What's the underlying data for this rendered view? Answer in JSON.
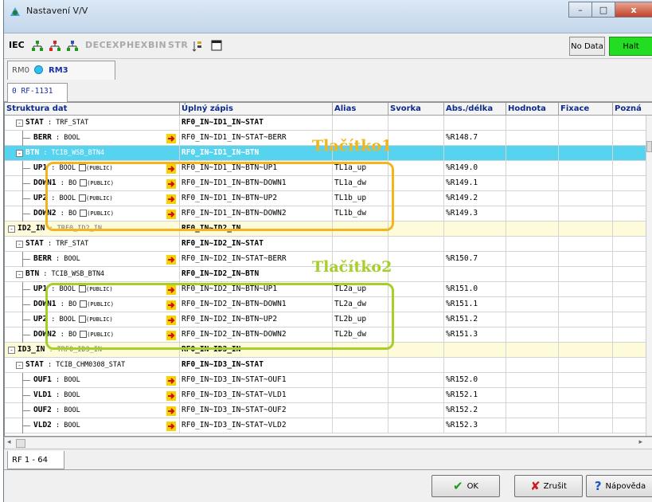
{
  "window": {
    "title": "Nastavení V/V",
    "minimize": "–",
    "maximize": "□",
    "close": "x"
  },
  "toolbar": {
    "iec": "IEC",
    "formats": [
      "DEC",
      "EXP",
      "HEX",
      "BIN",
      "STR"
    ],
    "status_nodata": "No Data",
    "status_halt": "Halt"
  },
  "tabs_modules": [
    "RM0",
    "RM3"
  ],
  "tabs_rf": [
    "0 RF-1131"
  ],
  "columns": [
    "Struktura dat",
    "Úplný zápis",
    "Alias",
    "Svorka",
    "Abs./délka",
    "Hodnota",
    "Fixace",
    "Pozná"
  ],
  "rows": [
    {
      "name": "STAT",
      "type": " : TRF_STAT",
      "full": "RF0_IN~ID1_IN~STAT",
      "alias": "",
      "abs": ""
    },
    {
      "name": "BERR",
      "type": " : BOOL",
      "full": "RF0_IN~ID1_IN~STAT~BERR",
      "alias": "",
      "abs": "%R148.7"
    },
    {
      "name": "BTN",
      "type": " : TCIB_WSB_BTN4",
      "full": "RF0_IN~ID1_IN~BTN",
      "alias": "",
      "abs": ""
    },
    {
      "name": "UP1",
      "type": " : BOOL",
      "pub": "(PUBLIC)",
      "full": "RF0_IN~ID1_IN~BTN~UP1",
      "alias": "TL1a_up",
      "abs": "%R149.0"
    },
    {
      "name": "DOWN1",
      "type": " : BO",
      "pub": "(PUBLIC)",
      "full": "RF0_IN~ID1_IN~BTN~DOWN1",
      "alias": "TL1a_dw",
      "abs": "%R149.1"
    },
    {
      "name": "UP2",
      "type": " : BOOL",
      "pub": "(PUBLIC)",
      "full": "RF0_IN~ID1_IN~BTN~UP2",
      "alias": "TL1b_up",
      "abs": "%R149.2"
    },
    {
      "name": "DOWN2",
      "type": " : BO",
      "pub": "(PUBLIC)",
      "full": "RF0_IN~ID1_IN~BTN~DOWN2",
      "alias": "TL1b_dw",
      "abs": "%R149.3"
    },
    {
      "name": "ID2_IN",
      "type": " : TRF0_ID2_IN",
      "full": "RF0_IN~ID2_IN",
      "alias": "",
      "abs": ""
    },
    {
      "name": "STAT",
      "type": " : TRF_STAT",
      "full": "RF0_IN~ID2_IN~STAT",
      "alias": "",
      "abs": ""
    },
    {
      "name": "BERR",
      "type": " : BOOL",
      "full": "RF0_IN~ID2_IN~STAT~BERR",
      "alias": "",
      "abs": "%R150.7"
    },
    {
      "name": "BTN",
      "type": " : TCIB_WSB_BTN4",
      "full": "RF0_IN~ID2_IN~BTN",
      "alias": "",
      "abs": ""
    },
    {
      "name": "UP1",
      "type": " : BOOL",
      "pub": "(PUBLIC)",
      "full": "RF0_IN~ID2_IN~BTN~UP1",
      "alias": "TL2a_up",
      "abs": "%R151.0"
    },
    {
      "name": "DOWN1",
      "type": " : BO",
      "pub": "(PUBLIC)",
      "full": "RF0_IN~ID2_IN~BTN~DOWN1",
      "alias": "TL2a_dw",
      "abs": "%R151.1"
    },
    {
      "name": "UP2",
      "type": " : BOOL",
      "pub": "(PUBLIC)",
      "full": "RF0_IN~ID2_IN~BTN~UP2",
      "alias": "TL2b_up",
      "abs": "%R151.2"
    },
    {
      "name": "DOWN2",
      "type": " : BO",
      "pub": "(PUBLIC)",
      "full": "RF0_IN~ID2_IN~BTN~DOWN2",
      "alias": "TL2b_dw",
      "abs": "%R151.3"
    },
    {
      "name": "ID3_IN",
      "type": " : TRF0_ID3_IN",
      "full": "RF0_IN~ID3_IN",
      "alias": "",
      "abs": ""
    },
    {
      "name": "STAT",
      "type": " : TCIB_CHM0308_STAT",
      "full": "RF0_IN~ID3_IN~STAT",
      "alias": "",
      "abs": ""
    },
    {
      "name": "OUF1",
      "type": " : BOOL",
      "full": "RF0_IN~ID3_IN~STAT~OUF1",
      "alias": "",
      "abs": "%R152.0"
    },
    {
      "name": "VLD1",
      "type": " : BOOL",
      "full": "RF0_IN~ID3_IN~STAT~VLD1",
      "alias": "",
      "abs": "%R152.1"
    },
    {
      "name": "OUF2",
      "type": " : BOOL",
      "full": "RF0_IN~ID3_IN~STAT~OUF2",
      "alias": "",
      "abs": "%R152.2"
    },
    {
      "name": "VLD2",
      "type": " : BOOL",
      "full": "RF0_IN~ID3_IN~STAT~VLD2",
      "alias": "",
      "abs": "%R152.3"
    }
  ],
  "annotations": {
    "label1": "Tlačítko1",
    "label2": "Tlačítko2",
    "color1": "#f2b51d",
    "color2": "#a6cf2a"
  },
  "bottom_tab": "RF 1 - 64",
  "footer": {
    "ok": "OK",
    "cancel": "Zrušit",
    "help": "Nápověda"
  }
}
